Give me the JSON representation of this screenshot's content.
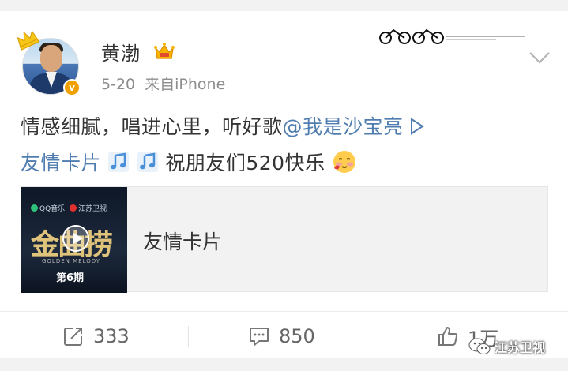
{
  "post": {
    "author": "黄渤",
    "date": "5-20",
    "source": "来自iPhone",
    "text_part1": "情感细腻，唱进心里，听好歌",
    "mention": "@我是沙宝亮",
    "card_link": "友情卡片",
    "text_part2": "祝朋友们520快乐",
    "icons": {
      "avatar_badge": "crown-icon",
      "verified": "v-badge",
      "member": "vip-crown-icon",
      "menu": "chevron-down-icon",
      "music": "music-note-icon",
      "emoji": "shy-face-emoji"
    },
    "verified_badge_text": "v"
  },
  "card": {
    "title": "友情卡片",
    "thumbnail": {
      "logo_left": "QQ音乐",
      "logo_right": "江苏卫视",
      "show_title": "金曲捞",
      "subtitle": "GOLDEN MELODY",
      "episode": "第6期"
    }
  },
  "actions": {
    "repost_count": "333",
    "comment_count": "850",
    "like_count": "1万"
  },
  "watermark": {
    "label": "江苏卫视"
  },
  "colors": {
    "link": "#507daf",
    "text": "#333333",
    "meta": "#8c8c8c",
    "badge": "#f0a000"
  }
}
